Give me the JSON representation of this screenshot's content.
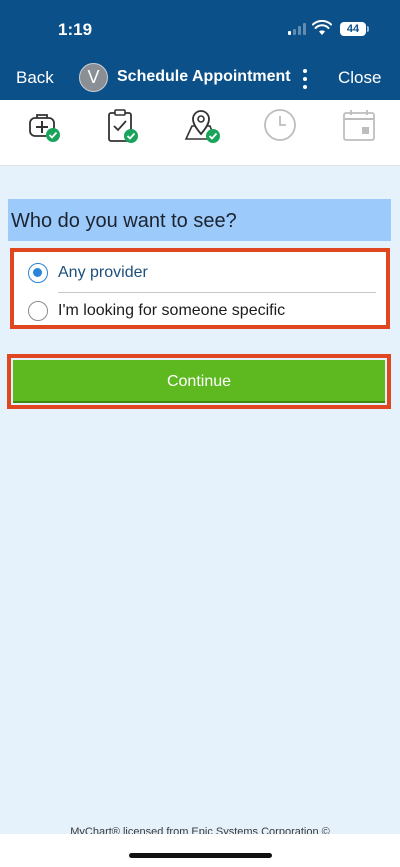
{
  "status_bar": {
    "time": "1:19",
    "battery": "44"
  },
  "nav": {
    "back_label": "Back",
    "avatar_initial": "V",
    "title": "Schedule Appointment",
    "close_label": "Close"
  },
  "steps": [
    {
      "icon": "medical-bag-icon",
      "completed": true
    },
    {
      "icon": "clipboard-check-icon",
      "completed": true
    },
    {
      "icon": "map-pin-icon",
      "completed": true
    },
    {
      "icon": "clock-icon",
      "completed": false
    },
    {
      "icon": "calendar-icon",
      "completed": false
    }
  ],
  "question": "Who do you want to see?",
  "options": [
    {
      "label": "Any provider",
      "selected": true
    },
    {
      "label": "I'm looking for someone specific",
      "selected": false
    }
  ],
  "continue_label": "Continue",
  "footer": "MyChart® licensed from Epic Systems Corporation ©",
  "colors": {
    "header": "#0b5088",
    "accent": "#5eb81f",
    "highlight_border": "#e0461f",
    "selected_radio": "#2a84d8",
    "question_bg": "#9ccafa",
    "page_bg": "#e6f2fb"
  }
}
